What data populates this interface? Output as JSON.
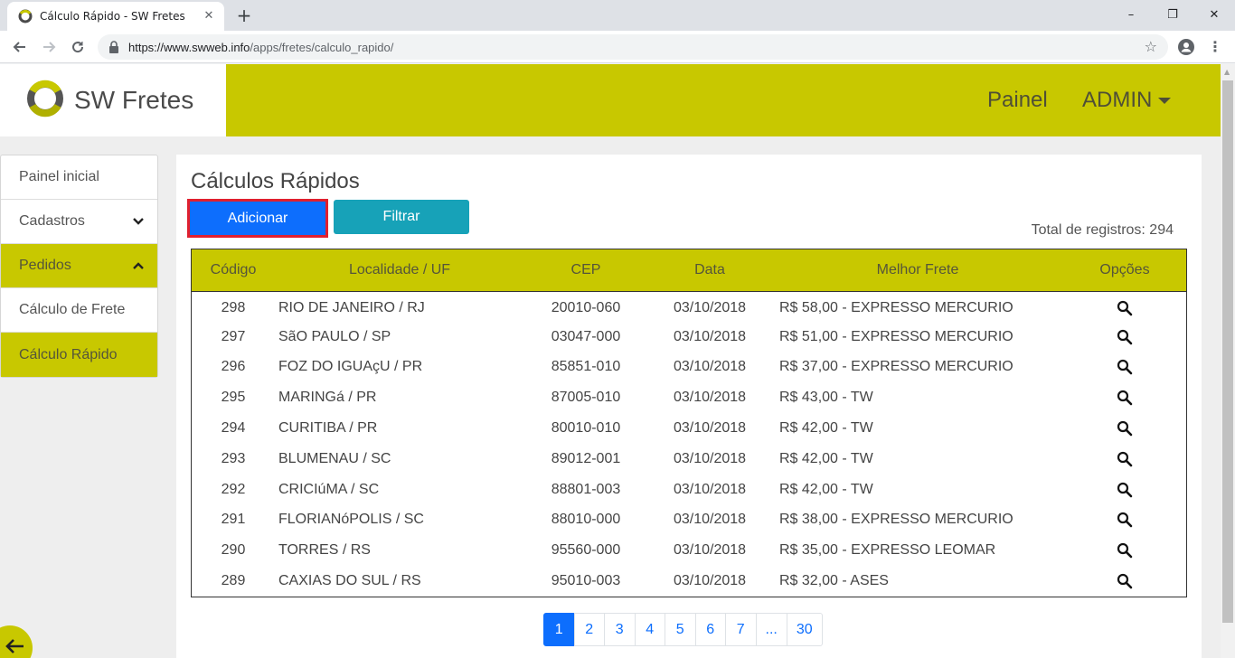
{
  "browser": {
    "tab_title": "Cálculo Rápido - SW Fretes",
    "tab_close": "✕",
    "new_tab": "+",
    "url_domain": "https://www.swweb.info",
    "url_path": "/apps/fretes/calculo_rapido/",
    "window_controls": {
      "minimize": "–",
      "restore": "❐",
      "close": "✕"
    }
  },
  "header": {
    "brand": "SW Fretes",
    "nav_painel": "Painel",
    "nav_admin": "ADMIN"
  },
  "sidebar": {
    "items": [
      {
        "label": "Painel inicial",
        "active": false
      },
      {
        "label": "Cadastros",
        "active": false,
        "chevron": "down"
      },
      {
        "label": "Pedidos",
        "active": true,
        "chevron": "up"
      },
      {
        "label": "Cálculo de Frete",
        "active": false
      },
      {
        "label": "Cálculo Rápido",
        "active": true
      }
    ]
  },
  "main": {
    "title": "Cálculos Rápidos",
    "add_button": "Adicionar",
    "filter_button": "Filtrar",
    "total_label": "Total de registros: 294",
    "table": {
      "headers": [
        "Código",
        "Localidade / UF",
        "CEP",
        "Data",
        "Melhor Frete",
        "Opções"
      ],
      "rows": [
        [
          "298",
          "RIO DE JANEIRO / RJ",
          "20010-060",
          "03/10/2018",
          "R$ 58,00 - EXPRESSO MERCURIO"
        ],
        [
          "297",
          "SãO PAULO / SP",
          "03047-000",
          "03/10/2018",
          "R$ 51,00 - EXPRESSO MERCURIO"
        ],
        [
          "296",
          "FOZ DO IGUAçU / PR",
          "85851-010",
          "03/10/2018",
          "R$ 37,00 - EXPRESSO MERCURIO"
        ],
        [
          "295",
          "MARINGá / PR",
          "87005-010",
          "03/10/2018",
          "R$ 43,00 - TW"
        ],
        [
          "294",
          "CURITIBA / PR",
          "80010-010",
          "03/10/2018",
          "R$ 42,00 - TW"
        ],
        [
          "293",
          "BLUMENAU / SC",
          "89012-001",
          "03/10/2018",
          "R$ 42,00 - TW"
        ],
        [
          "292",
          "CRICIúMA / SC",
          "88801-003",
          "03/10/2018",
          "R$ 42,00 - TW"
        ],
        [
          "291",
          "FLORIANóPOLIS / SC",
          "88010-000",
          "03/10/2018",
          "R$ 38,00 - EXPRESSO MERCURIO"
        ],
        [
          "290",
          "TORRES / RS",
          "95560-000",
          "03/10/2018",
          "R$ 35,00 - EXPRESSO LEOMAR"
        ],
        [
          "289",
          "CAXIAS DO SUL / RS",
          "95010-003",
          "03/10/2018",
          "R$ 32,00 - ASES"
        ]
      ],
      "row_action_icon": "search-icon"
    },
    "pagination": [
      "1",
      "2",
      "3",
      "4",
      "5",
      "6",
      "7",
      "...",
      "30"
    ],
    "pagination_active": "1"
  },
  "colors": {
    "accent": "#c8c800",
    "primary": "#0d6efd",
    "info": "#17a2b8",
    "highlight_border": "#e0202f"
  }
}
